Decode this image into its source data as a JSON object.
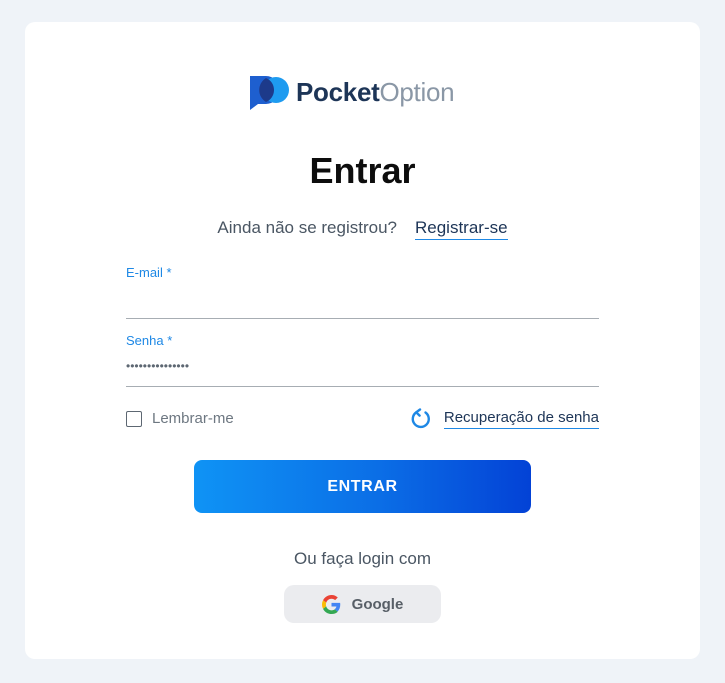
{
  "brand": {
    "name_part1": "Pocket",
    "name_part2": "Option"
  },
  "page": {
    "title": "Entrar"
  },
  "register": {
    "prompt": "Ainda não se registrou?",
    "link_label": "Registrar-se"
  },
  "form": {
    "email": {
      "label": "E-mail *",
      "value": ""
    },
    "password": {
      "label": "Senha *",
      "masked_value": "•••••••••••••••"
    },
    "remember_label": "Lembrar-me",
    "remember_checked": false,
    "recover_label": "Recuperação de senha",
    "submit_label": "ENTRAR"
  },
  "social": {
    "prompt": "Ou faça login com",
    "google_label": "Google"
  },
  "colors": {
    "background": "#eff3f8",
    "accent": "#1e88e5",
    "brand_dark": "#1d3557",
    "button_start": "#0f93f5",
    "button_end": "#0342d6"
  }
}
